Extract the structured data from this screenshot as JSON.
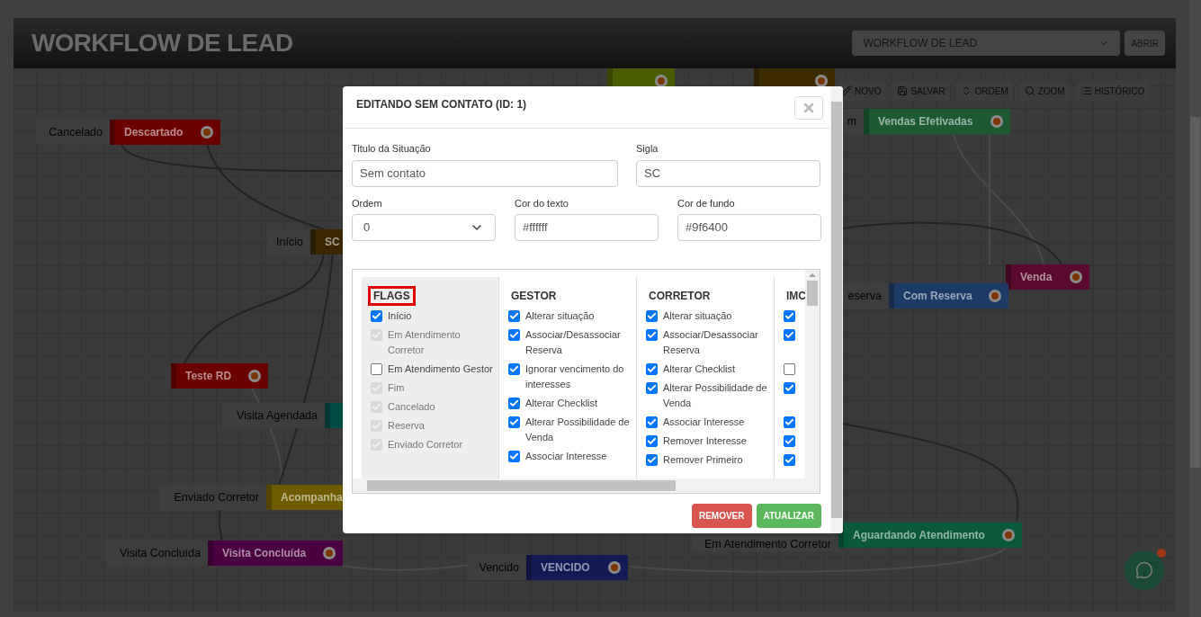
{
  "header": {
    "title": "WORKFLOW DE LEAD",
    "workflow_select": "WORKFLOW DE LEAD",
    "open_button": "ABRIR"
  },
  "toolbar": [
    {
      "kind": "pencil",
      "label": "NOVO"
    },
    {
      "kind": "save",
      "label": "SALVAR"
    },
    {
      "kind": "sort",
      "label": "ORDEM"
    },
    {
      "kind": "zoom",
      "label": "ZOOM"
    },
    {
      "kind": "list",
      "label": "HISTÓRICO"
    }
  ],
  "nodes": [
    {
      "color": "#4a5c00"
    },
    {
      "color": "#3c2a00"
    },
    {
      "label": "Cancelado",
      "title": "Descartado",
      "color": "#6a0000"
    },
    {
      "label": "Início",
      "title": "SC",
      "color": "#3a2700"
    },
    {
      "label": "m",
      "title": "Vendas Efetivadas",
      "color": "#1d5a32"
    },
    {
      "title": "Venda",
      "color": "#5a0a2e"
    },
    {
      "label": "eserva",
      "title": "Com Reserva",
      "color": "#1e3a66"
    },
    {
      "title": "Teste RD",
      "color": "#6a0000"
    },
    {
      "label": "Visita Agendada",
      "color": "#004d46"
    },
    {
      "label": "Enviado Corretor",
      "title": "Acompanha",
      "color": "#6e5d00"
    },
    {
      "label": "Visita Concluída",
      "title": "Visita Concluída",
      "color": "#4a0040"
    },
    {
      "label": "Vencido",
      "title": "VENCIDO",
      "color": "#141a55"
    },
    {
      "label": "Em Atendimento Corretor",
      "title": "Aguardando Atendimento",
      "color": "#0a5a3a"
    }
  ],
  "modal": {
    "title": "EDITANDO SEM CONTATO (ID: 1)",
    "fields": {
      "title_label": "Titulo da Situação",
      "title_value": "Sem contato",
      "abbr_label": "Sigla",
      "abbr_value": "SC",
      "order_label": "Ordem",
      "order_value": "0",
      "text_color_label": "Cor do texto",
      "text_color_value": "#ffffff",
      "bg_color_label": "Cor de fundo",
      "bg_color_value": "#9f6400"
    },
    "permissions": [
      {
        "heading": "FLAGS",
        "highlighted": true,
        "shaded": true,
        "items": [
          {
            "label": "Início",
            "checked": true,
            "disabled": false
          },
          {
            "label": "Em Atendimento Corretor",
            "checked": true,
            "disabled": true
          },
          {
            "label": "Em Atendimento Gestor",
            "checked": false,
            "disabled": false
          },
          {
            "label": "Fim",
            "checked": true,
            "disabled": true
          },
          {
            "label": "Cancelado",
            "checked": true,
            "disabled": true
          },
          {
            "label": "Reserva",
            "checked": true,
            "disabled": true
          },
          {
            "label": "Enviado Corretor",
            "checked": true,
            "disabled": true
          }
        ]
      },
      {
        "heading": "GESTOR",
        "highlighted": false,
        "shaded": false,
        "items": [
          {
            "label": "Alterar situação",
            "checked": true,
            "disabled": false
          },
          {
            "label": "Associar/Desassociar Reserva",
            "checked": true,
            "disabled": false
          },
          {
            "label": "Ignorar vencimento do interesses",
            "checked": true,
            "disabled": false
          },
          {
            "label": "Alterar Checklist",
            "checked": true,
            "disabled": false
          },
          {
            "label": "Alterar Possibilidade de Venda",
            "checked": true,
            "disabled": false
          },
          {
            "label": "Associar Interesse",
            "checked": true,
            "disabled": false
          }
        ]
      },
      {
        "heading": "CORRETOR",
        "highlighted": false,
        "shaded": false,
        "items": [
          {
            "label": "Alterar situação",
            "checked": true,
            "disabled": false
          },
          {
            "label": "Associar/Desassociar Reserva",
            "checked": true,
            "disabled": false
          },
          {
            "label": "Alterar Checklist",
            "checked": true,
            "disabled": false
          },
          {
            "label": "Alterar Possibilidade de Venda",
            "checked": true,
            "disabled": false
          },
          {
            "label": "Associar Interesse",
            "checked": true,
            "disabled": false
          },
          {
            "label": "Remover Interesse",
            "checked": true,
            "disabled": false
          },
          {
            "label": "Remover Primeiro",
            "checked": true,
            "disabled": false
          }
        ]
      },
      {
        "heading": "IMC",
        "highlighted": false,
        "shaded": false,
        "items": [
          {
            "checked": true,
            "disabled": false
          },
          {
            "checked": true,
            "disabled": false
          },
          {
            "checked": false,
            "disabled": false
          },
          {
            "checked": true,
            "disabled": false
          },
          {
            "checked": true,
            "disabled": false
          },
          {
            "checked": true,
            "disabled": false
          },
          {
            "checked": true,
            "disabled": false
          }
        ]
      }
    ],
    "buttons": [
      {
        "kind": "danger",
        "label": "REMOVER"
      },
      {
        "kind": "success",
        "label": "ATUALIZAR"
      }
    ]
  }
}
